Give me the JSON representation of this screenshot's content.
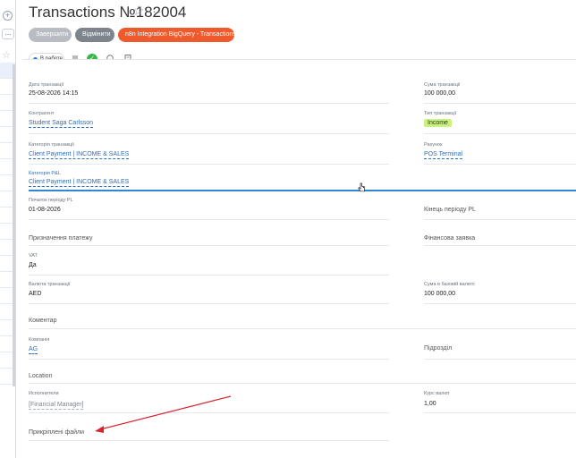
{
  "left": {
    "plus_icon": "+",
    "more_icon": "...",
    "star_icon": "☆"
  },
  "header": {
    "title": "Transactions №182004",
    "star_icon": "☆",
    "more_icon": "···"
  },
  "actions": {
    "finish": "Завершити",
    "cancel": "Відмінити",
    "integration": "n8n Integration BigQuery - Transactions"
  },
  "toolbar": {
    "status": "В работе",
    "icons": [
      "list-icon",
      "check-icon",
      "refresh-icon",
      "note-icon"
    ],
    "check_symbol": "✓"
  },
  "fields": {
    "date_label": "Дата транзакції",
    "date_value": "25-08-2026 14:15",
    "amount_label": "Сума транзакції",
    "amount_value": "100 000,00",
    "counterparty_label": "Контрагент",
    "counterparty_value": "Student Saga Carlsson",
    "type_label": "Тип транзакції",
    "type_value": "Income",
    "category_label": "Категорія транзакції",
    "category_value": "Client Payment | INCOME & SALES",
    "account_label": "Рахунок",
    "account_value": "POS Terminal",
    "pl_category_label": "Категорія P&L",
    "pl_category_value": "Client Payment | INCOME & SALES",
    "pl_start_label": "Початок періоду PL",
    "pl_start_value": "01-08-2026",
    "pl_end_label": "Кінець періоду PL",
    "purpose_label": "Призначення платежу",
    "fin_request_label": "Фінансова заявка",
    "vat_label": "VAT",
    "vat_value": "Да",
    "currency_label": "Валюта транзакції",
    "currency_value": "AED",
    "base_amount_label": "Сума в базовій валюті",
    "base_amount_value": "100 000,00",
    "comment_label": "Коментар",
    "company_label": "Компанія",
    "company_value": "AG",
    "division_label": "Підрозділ",
    "location_label": "Location",
    "executor_label": "Исполнители",
    "executor_value": "[Financial Manager]",
    "rate_label": "Курс валют",
    "rate_value": "1,00",
    "files_label": "Прикріплені файли"
  },
  "colors": {
    "accent_orange": "#ee5a2b",
    "link_blue": "#2f6db5",
    "income_badge": "#c9f37f",
    "annotation_red": "#d9232d"
  }
}
